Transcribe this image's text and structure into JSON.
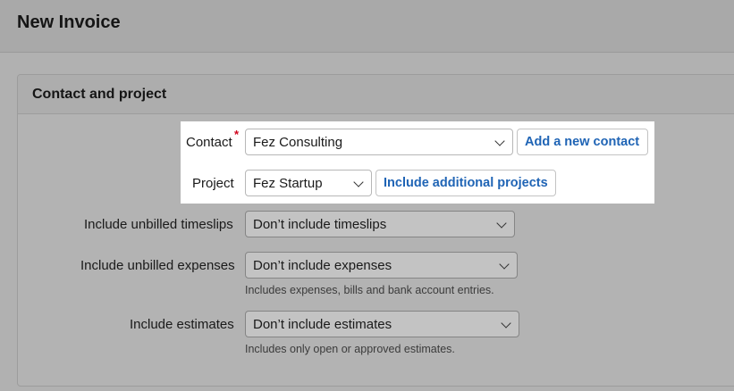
{
  "page": {
    "title": "New Invoice"
  },
  "panel": {
    "title": "Contact and project"
  },
  "form": {
    "contact": {
      "label": "Contact",
      "required_mark": "*",
      "value": "Fez Consulting",
      "button": "Add a new contact"
    },
    "project": {
      "label": "Project",
      "value": "Fez Startup",
      "button": "Include additional projects"
    },
    "timeslips": {
      "label": "Include unbilled timeslips",
      "value": "Don’t include timeslips"
    },
    "expenses": {
      "label": "Include unbilled expenses",
      "value": "Don’t include expenses",
      "hint": "Includes expenses, bills and bank account entries."
    },
    "estimates": {
      "label": "Include estimates",
      "value": "Don’t include estimates",
      "hint": "Includes only open or approved estimates."
    }
  }
}
